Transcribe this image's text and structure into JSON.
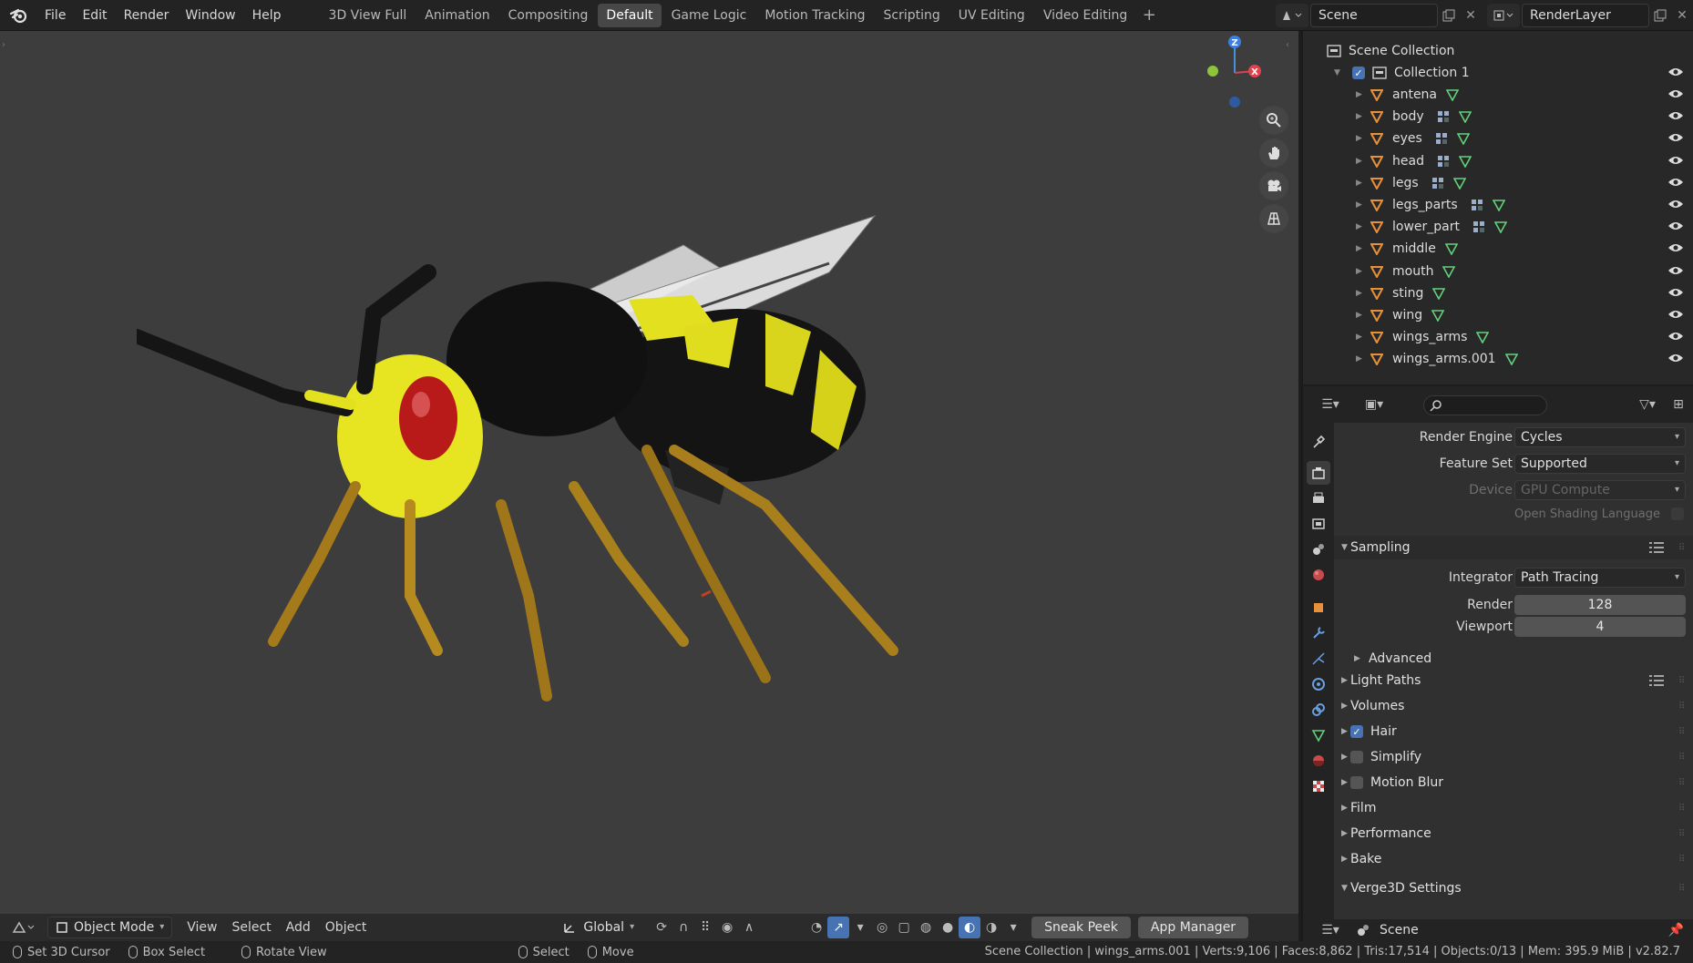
{
  "menu": [
    "File",
    "Edit",
    "Render",
    "Window",
    "Help"
  ],
  "workspaces": [
    {
      "label": "3D View Full",
      "active": false
    },
    {
      "label": "Animation",
      "active": false
    },
    {
      "label": "Compositing",
      "active": false
    },
    {
      "label": "Default",
      "active": true
    },
    {
      "label": "Game Logic",
      "active": false
    },
    {
      "label": "Motion Tracking",
      "active": false
    },
    {
      "label": "Scripting",
      "active": false
    },
    {
      "label": "UV Editing",
      "active": false
    },
    {
      "label": "Video Editing",
      "active": false
    }
  ],
  "scene": {
    "name": "Scene",
    "view_layer": "RenderLayer"
  },
  "gizmo": {
    "z": "Z",
    "x": "X"
  },
  "viewport_header": {
    "mode": "Object Mode",
    "menus": [
      "View",
      "Select",
      "Add",
      "Object"
    ],
    "orientation": "Global",
    "sneak_peek": "Sneak Peek",
    "app_manager": "App Manager"
  },
  "status": {
    "set_cursor": "Set 3D Cursor",
    "box_select": "Box Select",
    "rotate_view": "Rotate View",
    "select": "Select",
    "move": "Move",
    "stats": "Scene Collection | wings_arms.001 | Verts:9,106 | Faces:8,862 | Tris:17,514 | Objects:0/13 | Mem: 395.9 MiB | v2.82.7"
  },
  "outliner": {
    "root": "Scene Collection",
    "collection": "Collection 1",
    "objects": [
      {
        "name": "antena",
        "modifier": false
      },
      {
        "name": "body",
        "modifier": true
      },
      {
        "name": "eyes",
        "modifier": true
      },
      {
        "name": "head",
        "modifier": true
      },
      {
        "name": "legs",
        "modifier": true
      },
      {
        "name": "legs_parts",
        "modifier": true
      },
      {
        "name": "lower_part",
        "modifier": true
      },
      {
        "name": "middle",
        "modifier": false
      },
      {
        "name": "mouth",
        "modifier": false
      },
      {
        "name": "sting",
        "modifier": false
      },
      {
        "name": "wing",
        "modifier": false
      },
      {
        "name": "wings_arms",
        "modifier": false
      },
      {
        "name": "wings_arms.001",
        "modifier": false
      }
    ]
  },
  "properties": {
    "render_engine_label": "Render Engine",
    "render_engine": "Cycles",
    "feature_set_label": "Feature Set",
    "feature_set": "Supported",
    "device_label": "Device",
    "device": "GPU Compute",
    "osl_label": "Open Shading Language",
    "sampling": "Sampling",
    "integrator_label": "Integrator",
    "integrator": "Path Tracing",
    "render_label": "Render",
    "render_samples": "128",
    "viewport_label": "Viewport",
    "viewport_samples": "4",
    "advanced": "Advanced",
    "panels": [
      {
        "label": "Light Paths",
        "checkbox": null,
        "list": true
      },
      {
        "label": "Volumes",
        "checkbox": null,
        "list": false
      },
      {
        "label": "Hair",
        "checkbox": true,
        "list": false
      },
      {
        "label": "Simplify",
        "checkbox": false,
        "list": false
      },
      {
        "label": "Motion Blur",
        "checkbox": false,
        "list": false
      },
      {
        "label": "Film",
        "checkbox": null,
        "list": false
      },
      {
        "label": "Performance",
        "checkbox": null,
        "list": false
      },
      {
        "label": "Bake",
        "checkbox": null,
        "list": false
      }
    ],
    "verge": "Verge3D Settings",
    "footer_scene": "Scene"
  },
  "colors": {
    "accent": "#4772b3",
    "object_orange": "#e8913a",
    "mesh_green": "#63d17a"
  }
}
